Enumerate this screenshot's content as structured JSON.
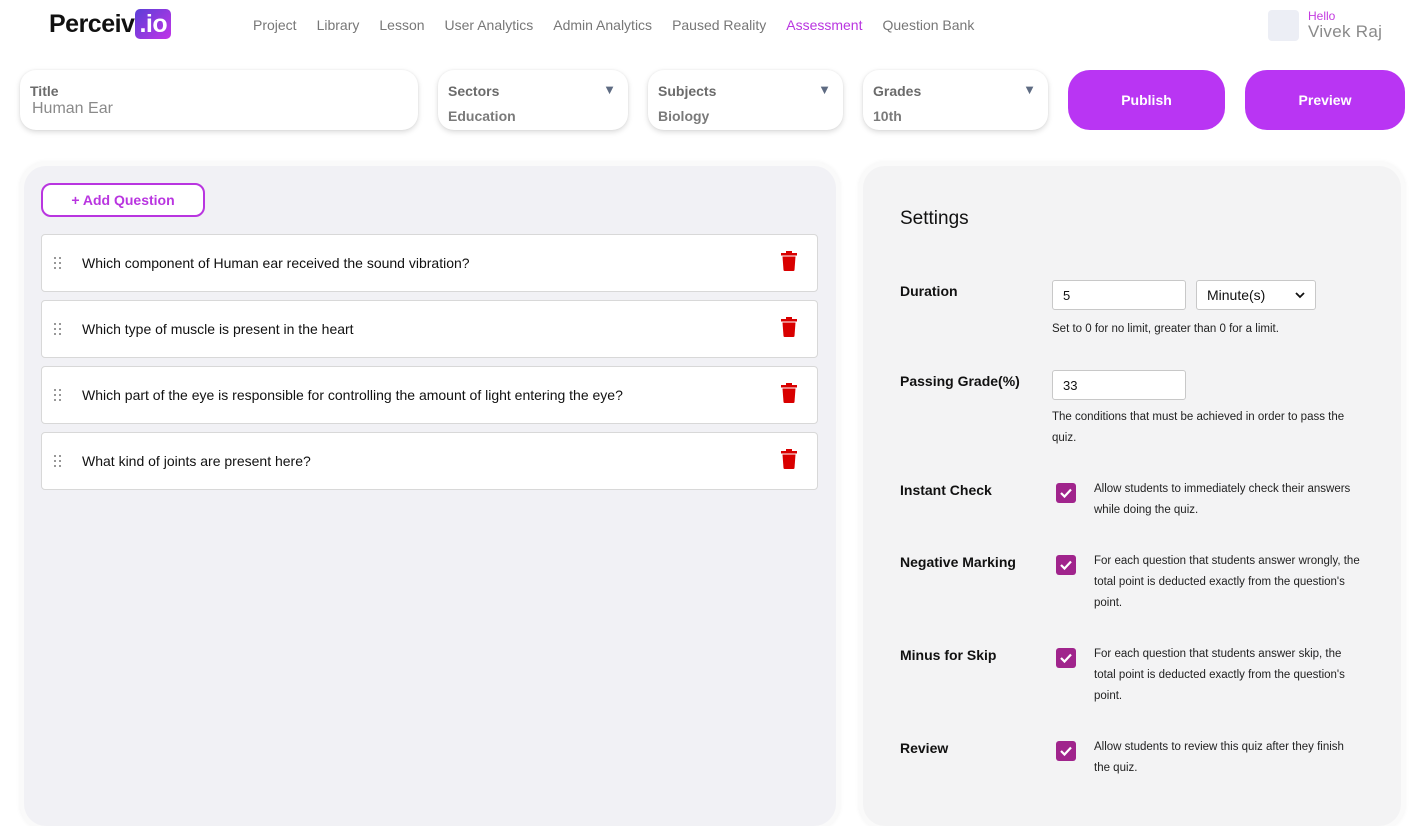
{
  "brand": {
    "name": "Perceiv",
    "suffix": ".io"
  },
  "nav": [
    "Project",
    "Library",
    "Lesson",
    "User Analytics",
    "Admin Analytics",
    "Paused Reality",
    "Assessment",
    "Question Bank"
  ],
  "nav_active": "Assessment",
  "user": {
    "greeting": "Hello",
    "name": "Vivek Raj"
  },
  "filters": {
    "title": {
      "label": "Title",
      "value": "Human Ear"
    },
    "sectors": {
      "label": "Sectors",
      "value": "Education"
    },
    "subjects": {
      "label": "Subjects",
      "value": "Biology"
    },
    "grades": {
      "label": "Grades",
      "value": "10th"
    }
  },
  "actions": {
    "publish": "Publish",
    "preview": "Preview"
  },
  "questions_panel": {
    "add_label": "+ Add Question",
    "questions": [
      "Which component of Human ear received the sound vibration?",
      "Which type of muscle is present in the heart",
      "Which part of the eye is responsible for controlling the amount of light entering the eye?",
      "What kind of joints are present here?"
    ]
  },
  "settings": {
    "title": "Settings",
    "duration": {
      "label": "Duration",
      "value": "5",
      "unit": "Minute(s)",
      "help": "Set to 0 for no limit, greater than 0 for a limit."
    },
    "passing": {
      "label": "Passing Grade(%)",
      "value": "33",
      "help_1": "The conditions that must be achieved in order to pass the",
      "help_2": "quiz."
    },
    "instant": {
      "label": "Instant Check",
      "checked": true,
      "help_1": "Allow students to immediately check their answers",
      "help_2": "while doing the quiz."
    },
    "negative": {
      "label": "Negative Marking",
      "checked": true,
      "help_1": "For each question that students answer wrongly, the",
      "help_2": "total point is deducted exactly from the question's",
      "help_3": "point."
    },
    "skip": {
      "label": "Minus for Skip",
      "checked": true,
      "help_1": "For each question that students answer skip, the",
      "help_2": "total point is deducted exactly from the question's",
      "help_3": "point."
    },
    "review": {
      "label": "Review",
      "checked": true,
      "help_1": "Allow students to review this quiz after they finish",
      "help_2": "the quiz."
    }
  },
  "colors": {
    "accent": "#b935f3",
    "checkbox": "#a0248c",
    "delete": "#d90000"
  }
}
